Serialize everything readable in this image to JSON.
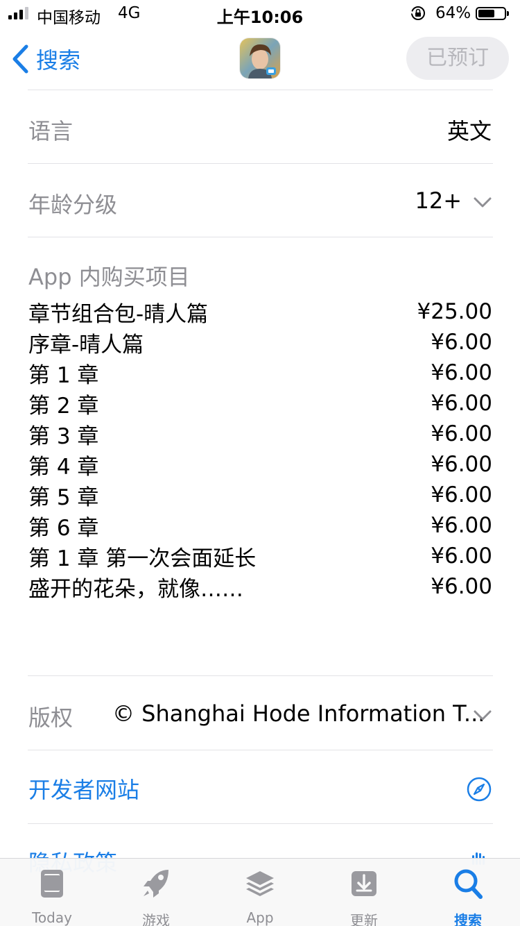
{
  "status_bar": {
    "carrier": "中国移动",
    "network": "4G",
    "time": "上午10:06",
    "battery_percent": "64%",
    "battery_level": 0.64,
    "signal_bars_on": 3,
    "signal_bars_total": 4
  },
  "nav": {
    "back_label": "搜索",
    "preorder_label": "已预订",
    "app_icon": "game-character-portrait"
  },
  "info": {
    "language_label": "语言",
    "language_value": "英文",
    "age_label": "年龄分级",
    "age_value": "12+",
    "iap_title": "App 内购买项目",
    "iap_items": [
      {
        "name": "章节组合包-晴人篇",
        "price": "¥25.00"
      },
      {
        "name": "序章-晴人篇",
        "price": "¥6.00"
      },
      {
        "name": "第 1 章",
        "price": "¥6.00"
      },
      {
        "name": "第 2 章",
        "price": "¥6.00"
      },
      {
        "name": "第 3 章",
        "price": "¥6.00"
      },
      {
        "name": "第 4 章",
        "price": "¥6.00"
      },
      {
        "name": "第 5 章",
        "price": "¥6.00"
      },
      {
        "name": "第 6 章",
        "price": "¥6.00"
      },
      {
        "name": "第 1 章 第一次会面延长",
        "price": "¥6.00"
      },
      {
        "name": "盛开的花朵，就像……",
        "price": "¥6.00"
      }
    ],
    "copyright_label": "版权",
    "copyright_value": "© Shanghai Hode Information T...",
    "developer_site_label": "开发者网站",
    "privacy_label": "隐私政策"
  },
  "tabs": [
    {
      "label": "Today",
      "icon": "today-icon",
      "active": false
    },
    {
      "label": "游戏",
      "icon": "rocket-icon",
      "active": false
    },
    {
      "label": "App",
      "icon": "layers-icon",
      "active": false
    },
    {
      "label": "更新",
      "icon": "download-icon",
      "active": false
    },
    {
      "label": "搜索",
      "icon": "search-icon",
      "active": true
    }
  ],
  "colors": {
    "accent": "#1a7ee6",
    "secondary_text": "#8e8e93",
    "divider": "#e2e2e6"
  }
}
